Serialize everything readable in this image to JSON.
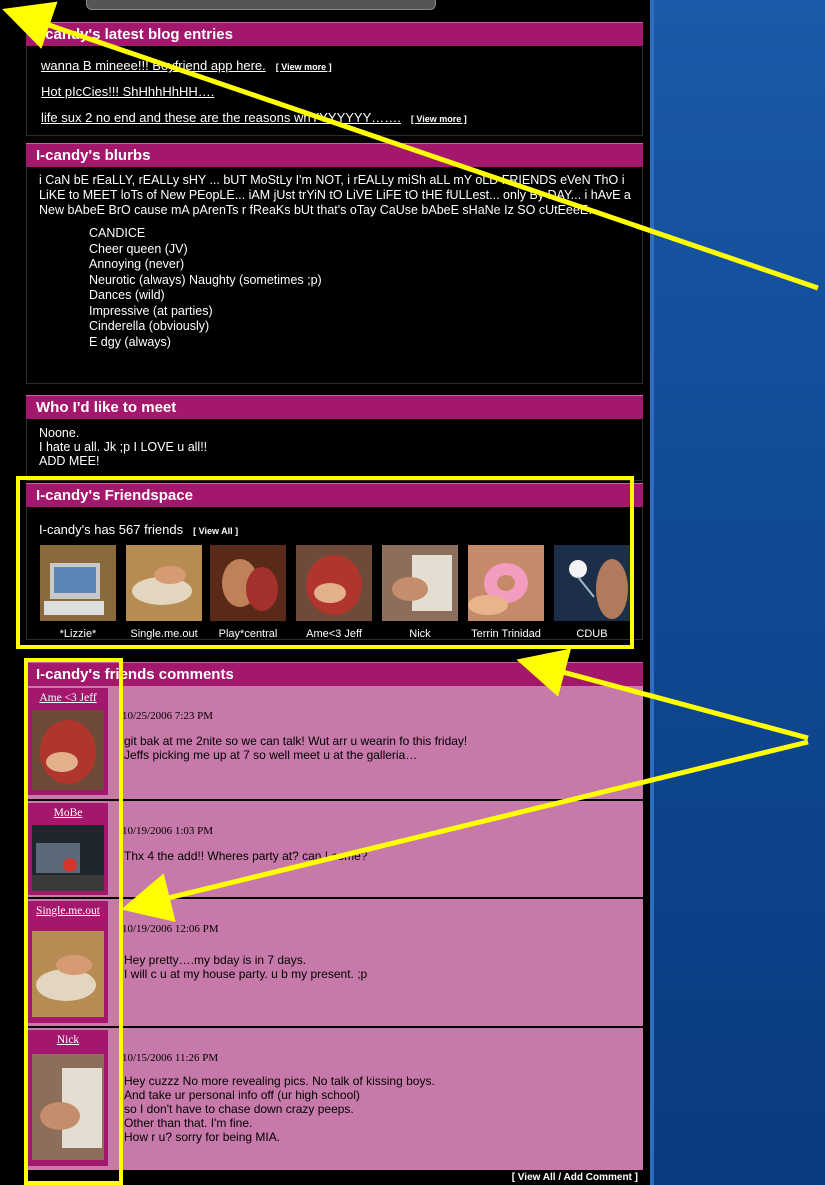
{
  "blog": {
    "title": "I-candy's latest blog entries",
    "entries": [
      {
        "text": "wanna B mineee!!! Boyfriend app here.",
        "more": "[ View more ]"
      },
      {
        "text": "Hot pIcCies!!! ShHhhHhHH….",
        "more": ""
      },
      {
        "text": "life sux 2 no end and these are the reasons whYYYYYYY…….",
        "more": "[ View more ]"
      }
    ]
  },
  "blurbs": {
    "title": "I-candy's blurbs",
    "intro": "i CaN bE rEaLLY, rEALLy sHY ... bUT MoStLy I'm NOT, i rEALLy miSh aLL mY oLD FRIENDS eVeN ThO i LiKE to MEET loTs of New PEopLE... iAM jUst trYiN tO LiVE LiFE tO tHE fULLest... only By DAY... i hAvE a New bAbeE BrO cause mA pArenTs r fReaKs bUt that's oTay CaUse bAbeE sHaNe Iz SO cUtEeeE….",
    "lines": [
      "CANDICE",
      "Cheer queen (JV)",
      "Annoying (never)",
      "Neurotic (always) Naughty (sometimes ;p)",
      "Dances (wild)",
      "Impressive (at parties)",
      "Cinderella (obviously)",
      "E dgy (always)"
    ]
  },
  "meet": {
    "title": "Who I'd like to meet",
    "lines": [
      "Noone.",
      "I hate u all. Jk ;p I LOVE u all!!",
      "ADD MEE!"
    ]
  },
  "friendspace": {
    "title": "I-candy's Friendspace",
    "count_text": "I-candy's has 567 friends",
    "view_all": "[ View All ]",
    "friends": [
      "*Lizzie*",
      "Single.me.out",
      "Play*central",
      "Ame<3 Jeff",
      "Nick",
      "Terrin Trinidad",
      "CDUB"
    ]
  },
  "comments": {
    "title": "I-candy's friends comments",
    "items": [
      {
        "name": "Ame <3 Jeff",
        "date": "10/25/2006 7:23 PM",
        "lines": [
          "git bak at me 2nite so we can talk! Wut arr u wearin fo this friday!",
          "Jeffs  picking me up at 7 so well meet u at the galleria…"
        ]
      },
      {
        "name": "MoBe",
        "date": "10/19/2006 1:03 PM",
        "lines": [
          "Thx 4 the add!! Wheres party at? can I come?"
        ]
      },
      {
        "name": "Single.me.out",
        "date": "10/19/2006 12:06 PM",
        "lines": [
          "Hey pretty….my bday is in 7 days.",
          "I will c u at my house party. u b my present. ;p"
        ]
      },
      {
        "name": "Nick",
        "date": "10/15/2006 11:26 PM",
        "lines": [
          "Hey cuzzz No more revealing pics. No talk of kissing boys.",
          "And take ur personal info off (ur high school)",
          "so I don't have to chase down crazy peeps.",
          "Other than that. I'm fine.",
          "How r u? sorry for being MIA."
        ]
      }
    ],
    "footer": "[ View All / Add Comment ]"
  },
  "colors": {
    "header_magenta": "#a3176d",
    "comment_pink": "#c77aa9",
    "annotation_yellow": "#ffff00",
    "background_blue": "#1a5aa8"
  }
}
